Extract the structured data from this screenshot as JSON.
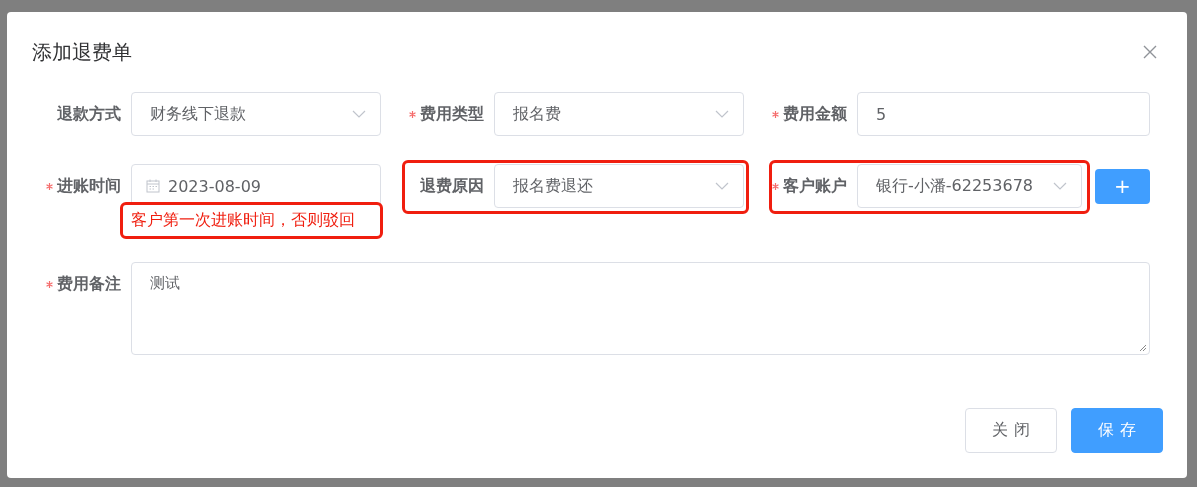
{
  "dialog": {
    "title": "添加退费单"
  },
  "fields": [
    {
      "kind": "select",
      "label": "退款方式",
      "required": false,
      "value": "财务线下退款",
      "highlighted": false
    },
    {
      "kind": "select",
      "label": "费用类型",
      "required": true,
      "value": "报名费",
      "highlighted": false
    },
    {
      "kind": "text",
      "label": "费用金额",
      "required": true,
      "value": "5",
      "highlighted": false
    },
    {
      "kind": "date",
      "label": "进账时间",
      "required": true,
      "value": "2023-08-09",
      "highlighted": false,
      "note": "客户第一次进账时间，否则驳回"
    },
    {
      "kind": "select",
      "label": "退费原因",
      "required": false,
      "value": "报名费退还",
      "highlighted": true
    },
    {
      "kind": "select",
      "label": "客户账户",
      "required": true,
      "value": "银行-小潘-62253678",
      "highlighted": true,
      "add_button": "+"
    },
    {
      "kind": "textarea",
      "label": "费用备注",
      "required": true,
      "value": "测试",
      "highlighted": false
    }
  ],
  "buttons": [
    {
      "label": "关 闭",
      "primary": false
    },
    {
      "label": "保 存",
      "primary": true
    }
  ]
}
